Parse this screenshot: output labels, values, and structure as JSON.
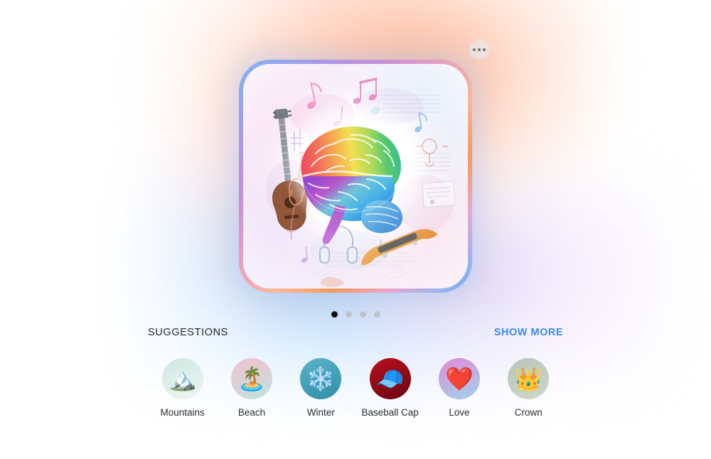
{
  "window": {
    "background_color": "#ffffff"
  },
  "options_button": {
    "icon": "ellipsis-horizontal-icon",
    "label": "More options"
  },
  "hero": {
    "alt": "Rainbow watercolor brain surrounded by musical instruments and notes",
    "border_colors": [
      "#7bb8f5",
      "#a59bea",
      "#c58fd8",
      "#e8a0c0",
      "#f8b89b",
      "#f79a5c",
      "#6aa9f2"
    ],
    "artwork": {
      "subject": "brain",
      "style": "rainbow watercolor sketch",
      "elements": [
        "guitar",
        "violin",
        "music-notes",
        "sheet-music",
        "skateboard",
        "headphones",
        "trumpet"
      ]
    }
  },
  "pagination": {
    "total": 4,
    "active_index": 0,
    "active_color": "#0f0f10",
    "inactive_color": "#bdc3c9"
  },
  "suggestions": {
    "title": "SUGGESTIONS",
    "show_more_label": "SHOW MORE",
    "show_more_color": "#3d8ce0",
    "items": [
      {
        "label": "Mountains",
        "emoji": "🏔️",
        "icon": "mountain-icon",
        "bg_from": "#cfe8e2",
        "bg_to": "#eef5f2"
      },
      {
        "label": "Beach",
        "emoji": "🏝️",
        "icon": "palm-tree-icon",
        "bg_from": "#f4c0cf",
        "bg_to": "#bfe3dc"
      },
      {
        "label": "Winter",
        "emoji": "❄️",
        "icon": "snowflake-icon",
        "bg_from": "#5bb3c9",
        "bg_to": "#2f8ea8"
      },
      {
        "label": "Baseball Cap",
        "emoji": "🧢",
        "icon": "baseball-cap-icon",
        "bg_from": "#b8101c",
        "bg_to": "#6b0410"
      },
      {
        "label": "Love",
        "emoji": "❤️",
        "icon": "heart-icon",
        "bg_from": "#e08ad6",
        "bg_to": "#9fd3ea"
      },
      {
        "label": "Crown",
        "emoji": "👑",
        "icon": "crown-icon",
        "bg_from": "#b9c6bc",
        "bg_to": "#cdd6cb"
      }
    ]
  }
}
